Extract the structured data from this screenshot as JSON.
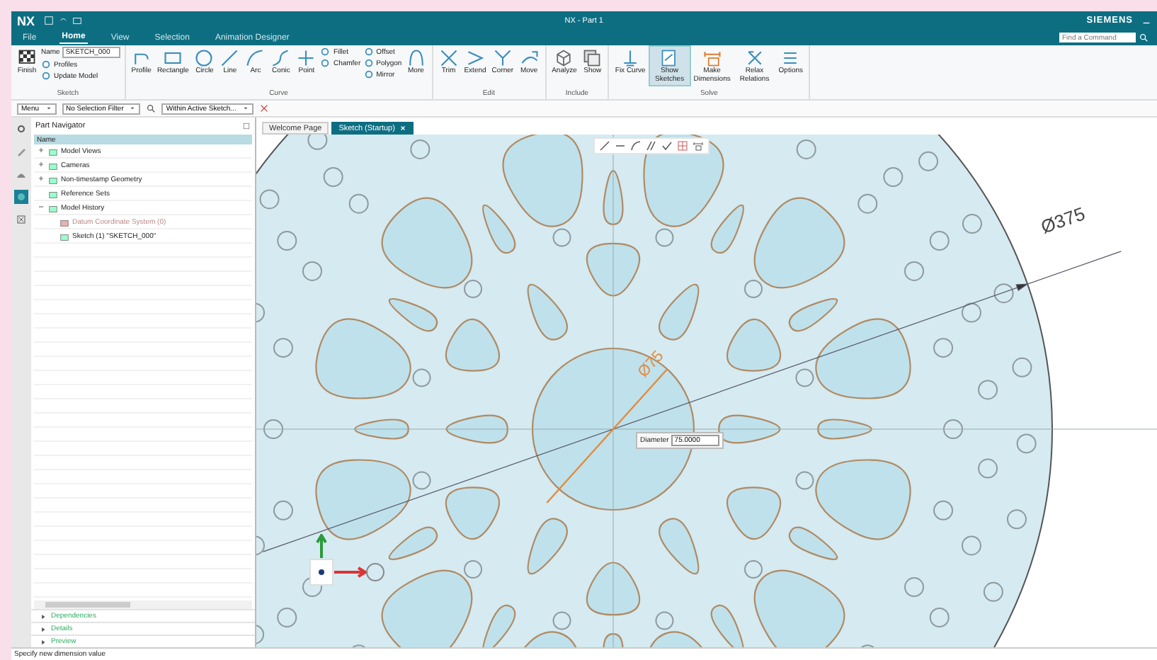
{
  "window": {
    "logo": "NX",
    "title": "NX - Part 1",
    "brand": "SIEMENS"
  },
  "menu_tabs": [
    {
      "label": "File",
      "selected": false
    },
    {
      "label": "Home",
      "selected": true
    },
    {
      "label": "View",
      "selected": false
    },
    {
      "label": "Selection",
      "selected": false
    },
    {
      "label": "Animation Designer",
      "selected": false
    }
  ],
  "search": {
    "placeholder": "Find a Command"
  },
  "ribbon": [
    {
      "label": "Sketch",
      "tools": [
        {
          "kind": "large",
          "label": "Finish",
          "on": false
        },
        {
          "kind": "stack",
          "items": [
            {
              "kind": "field",
              "label": "Name",
              "value": "SKETCH_000"
            },
            {
              "kind": "small",
              "label": "Profiles"
            },
            {
              "kind": "small",
              "label": "Update Model"
            }
          ]
        }
      ]
    },
    {
      "label": "Curve",
      "tools": [
        {
          "kind": "large",
          "label": "Profile",
          "on": false
        },
        {
          "kind": "large",
          "label": "Rectangle",
          "on": false
        },
        {
          "kind": "large",
          "label": "Circle",
          "on": false
        },
        {
          "kind": "large",
          "label": "Line",
          "on": false
        },
        {
          "kind": "large",
          "label": "Arc",
          "on": false
        },
        {
          "kind": "large",
          "label": "Conic",
          "on": false
        },
        {
          "kind": "large",
          "label": "Point",
          "on": false
        },
        {
          "kind": "stack",
          "items": [
            {
              "kind": "small",
              "label": "Fillet"
            },
            {
              "kind": "small",
              "label": "Chamfer"
            }
          ]
        },
        {
          "kind": "stack",
          "items": [
            {
              "kind": "small",
              "label": "Offset"
            },
            {
              "kind": "small",
              "label": "Polygon"
            },
            {
              "kind": "small",
              "label": "Mirror"
            }
          ]
        },
        {
          "kind": "large",
          "label": "More",
          "on": false
        }
      ]
    },
    {
      "label": "Edit",
      "tools": [
        {
          "kind": "large",
          "label": "Trim",
          "on": false
        },
        {
          "kind": "large",
          "label": "Extend",
          "on": false
        },
        {
          "kind": "large",
          "label": "Corner",
          "on": false
        },
        {
          "kind": "large",
          "label": "Move",
          "on": false
        }
      ]
    },
    {
      "label": "Include",
      "tools": [
        {
          "kind": "large",
          "label": "Analyze",
          "on": false
        },
        {
          "kind": "large",
          "label": "Show",
          "on": false
        }
      ]
    },
    {
      "label": "Solve",
      "tools": [
        {
          "kind": "large",
          "label": "Fix Curve",
          "on": false
        },
        {
          "kind": "large",
          "label": "Show Sketches",
          "on": true
        },
        {
          "kind": "large",
          "label": "Make Dimensions",
          "on": false
        },
        {
          "kind": "large",
          "label": "Relax Relations",
          "on": false
        },
        {
          "kind": "large",
          "label": "Options",
          "on": false
        }
      ]
    }
  ],
  "toolbar": {
    "menu": "Menu",
    "filter": "No Selection Filter",
    "scope": "Within Active Sketch..."
  },
  "resource_bar": [
    {
      "selected": false
    },
    {
      "selected": false
    },
    {
      "selected": false
    },
    {
      "selected": true
    },
    {
      "selected": false
    }
  ],
  "navigator": {
    "title": "Part Navigator",
    "column": "Name",
    "items": [
      {
        "label": "Model Views",
        "expanded": false,
        "dimmed": false
      },
      {
        "label": "Cameras",
        "expanded": false,
        "dimmed": false
      },
      {
        "label": "Non-timestamp Geometry",
        "expanded": false,
        "dimmed": false
      },
      {
        "label": "Reference Sets",
        "dimmed": false
      },
      {
        "label": "Model History",
        "expanded": true,
        "dimmed": false,
        "children": [
          {
            "label": "Datum Coordinate System (0)",
            "dimmed": true
          },
          {
            "label": "Sketch (1) \"SKETCH_000\"",
            "dimmed": false
          }
        ]
      }
    ],
    "panels": [
      {
        "label": "Dependencies",
        "expanded": false
      },
      {
        "label": "Details",
        "expanded": false
      },
      {
        "label": "Preview",
        "expanded": false
      }
    ]
  },
  "doc_tabs": [
    {
      "label": "Welcome Page",
      "selected": false
    },
    {
      "label": "Sketch (Startup)",
      "selected": true
    }
  ],
  "canvas": {
    "outer_dimension": "Ø375",
    "hub_dimension": "Ø75",
    "input": {
      "label": "Diameter",
      "value": "75.0000"
    }
  },
  "status_bar": "Specify new dimension value"
}
